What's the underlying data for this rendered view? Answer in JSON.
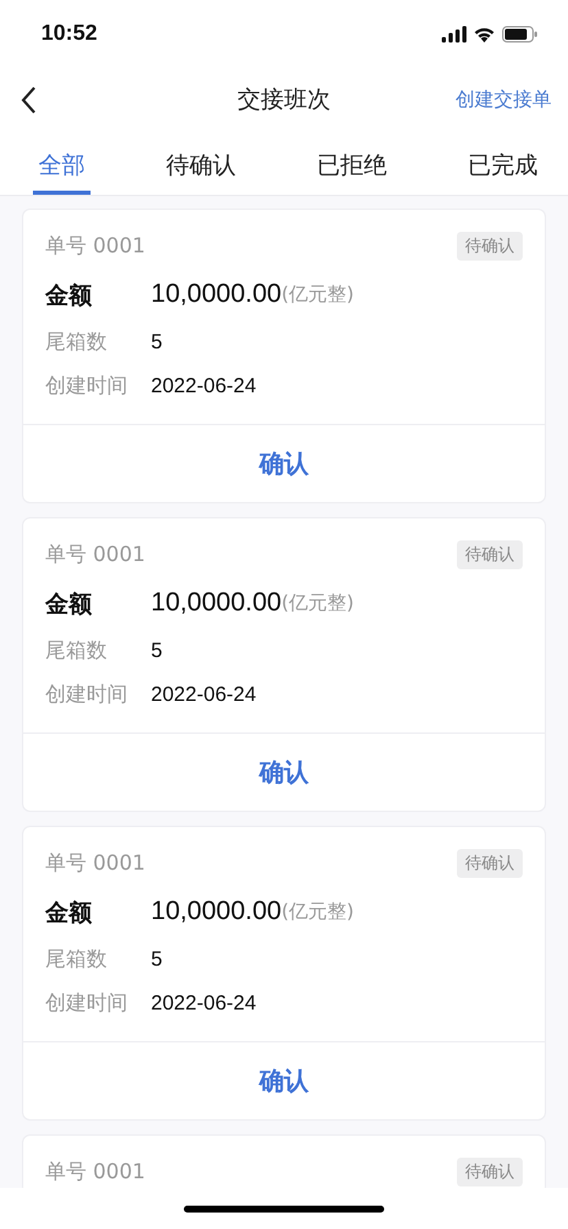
{
  "status_bar": {
    "time": "10:52"
  },
  "nav": {
    "title": "交接班次",
    "action": "创建交接单"
  },
  "tabs": [
    {
      "label": "全部",
      "selected": true
    },
    {
      "label": "待确认",
      "selected": false
    },
    {
      "label": "已拒绝",
      "selected": false
    },
    {
      "label": "已完成",
      "selected": false
    }
  ],
  "cards": [
    {
      "number": "单号 0001",
      "status": "待确认",
      "amount_label": "金额",
      "amount": "10,0000.00",
      "amount_unit": "(亿元整)",
      "fields": [
        {
          "label": "尾箱数",
          "value": "5"
        },
        {
          "label": "创建时间",
          "value": "2022-06-24"
        }
      ],
      "action": "确认"
    },
    {
      "number": "单号 0001",
      "status": "待确认",
      "amount_label": "金额",
      "amount": "10,0000.00",
      "amount_unit": "(亿元整)",
      "fields": [
        {
          "label": "尾箱数",
          "value": "5"
        },
        {
          "label": "创建时间",
          "value": "2022-06-24"
        }
      ],
      "action": "确认"
    },
    {
      "number": "单号 0001",
      "status": "待确认",
      "amount_label": "金额",
      "amount": "10,0000.00",
      "amount_unit": "(亿元整)",
      "fields": [
        {
          "label": "尾箱数",
          "value": "5"
        },
        {
          "label": "创建时间",
          "value": "2022-06-24"
        }
      ],
      "action": "确认"
    },
    {
      "number": "单号 0001",
      "status": "待确认"
    }
  ]
}
